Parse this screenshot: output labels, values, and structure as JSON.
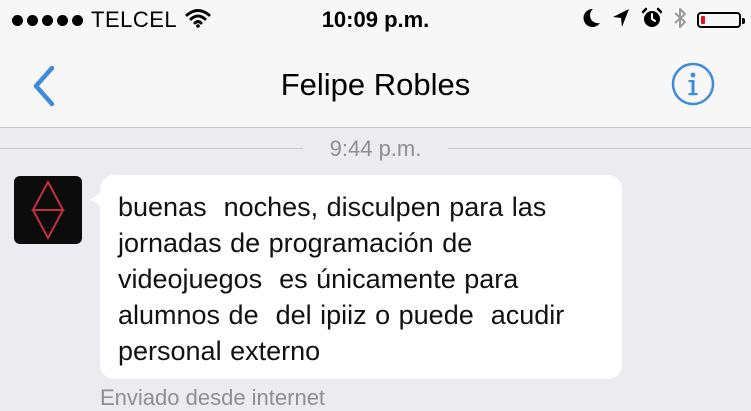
{
  "status_bar": {
    "carrier": "TELCEL",
    "time": "10:09 p.m.",
    "battery_level": 0.1,
    "battery_color": "#e0141e",
    "icons": [
      "signal-dots-icon",
      "wifi-icon",
      "moon-icon",
      "location-arrow-icon",
      "alarm-clock-icon",
      "bluetooth-icon",
      "battery-icon"
    ]
  },
  "nav": {
    "title": "Felipe Robles",
    "back_icon": "chevron-left-icon",
    "info_icon": "info-icon",
    "accent_color": "#3e8bd9"
  },
  "conversation": {
    "timestamp": "9:44 p.m.",
    "messages": [
      {
        "text": "buenas  noches, disculpen para las\njornadas de programación de\nvideojuegos  es únicamente para\nalumnos de  del ipiiz o puede  acudir\npersonal externo",
        "footer": "Enviado desde internet"
      }
    ]
  }
}
